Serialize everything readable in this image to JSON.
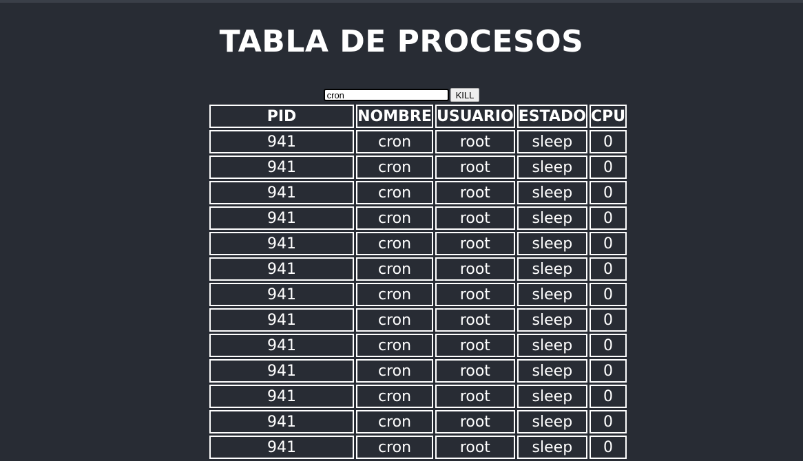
{
  "page": {
    "title": "TABLA DE PROCESOS"
  },
  "controls": {
    "input_value": "cron",
    "kill_label": "KILL"
  },
  "table": {
    "headers": [
      "PID",
      "NOMBRE",
      "USUARIO",
      "ESTADO",
      "CPU"
    ],
    "rows": [
      [
        "941",
        "cron",
        "root",
        "sleep",
        "0"
      ],
      [
        "941",
        "cron",
        "root",
        "sleep",
        "0"
      ],
      [
        "941",
        "cron",
        "root",
        "sleep",
        "0"
      ],
      [
        "941",
        "cron",
        "root",
        "sleep",
        "0"
      ],
      [
        "941",
        "cron",
        "root",
        "sleep",
        "0"
      ],
      [
        "941",
        "cron",
        "root",
        "sleep",
        "0"
      ],
      [
        "941",
        "cron",
        "root",
        "sleep",
        "0"
      ],
      [
        "941",
        "cron",
        "root",
        "sleep",
        "0"
      ],
      [
        "941",
        "cron",
        "root",
        "sleep",
        "0"
      ],
      [
        "941",
        "cron",
        "root",
        "sleep",
        "0"
      ],
      [
        "941",
        "cron",
        "root",
        "sleep",
        "0"
      ],
      [
        "941",
        "cron",
        "root",
        "sleep",
        "0"
      ],
      [
        "941",
        "cron",
        "root",
        "sleep",
        "0"
      ]
    ]
  }
}
